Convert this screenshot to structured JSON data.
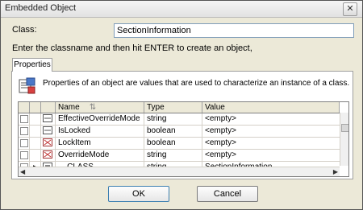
{
  "window": {
    "title": "Embedded Object"
  },
  "class_field": {
    "label": "Class:",
    "value": "SectionInformation"
  },
  "hint": "Enter the classname and then hit ENTER to create an object,",
  "tabs": [
    {
      "label": "Properties"
    }
  ],
  "properties": {
    "description": "Properties of an object are values that are used to characterize an instance of a class.",
    "columns": {
      "name": "Name",
      "type": "Type",
      "value": "Value"
    },
    "rows": [
      {
        "name": "EffectiveOverrideMode",
        "type": "string",
        "value": "<empty>",
        "icon": "property-icon"
      },
      {
        "name": "IsLocked",
        "type": "boolean",
        "value": "<empty>",
        "icon": "property-icon"
      },
      {
        "name": "LockItem",
        "type": "boolean",
        "value": "<empty>",
        "icon": "key-property-icon"
      },
      {
        "name": "OverrideMode",
        "type": "string",
        "value": "<empty>",
        "icon": "key-property-icon"
      },
      {
        "name": "__CLASS",
        "type": "string",
        "value": "SectionInformation",
        "icon": "system-property-icon"
      }
    ]
  },
  "buttons": {
    "ok": "OK",
    "cancel": "Cancel"
  }
}
